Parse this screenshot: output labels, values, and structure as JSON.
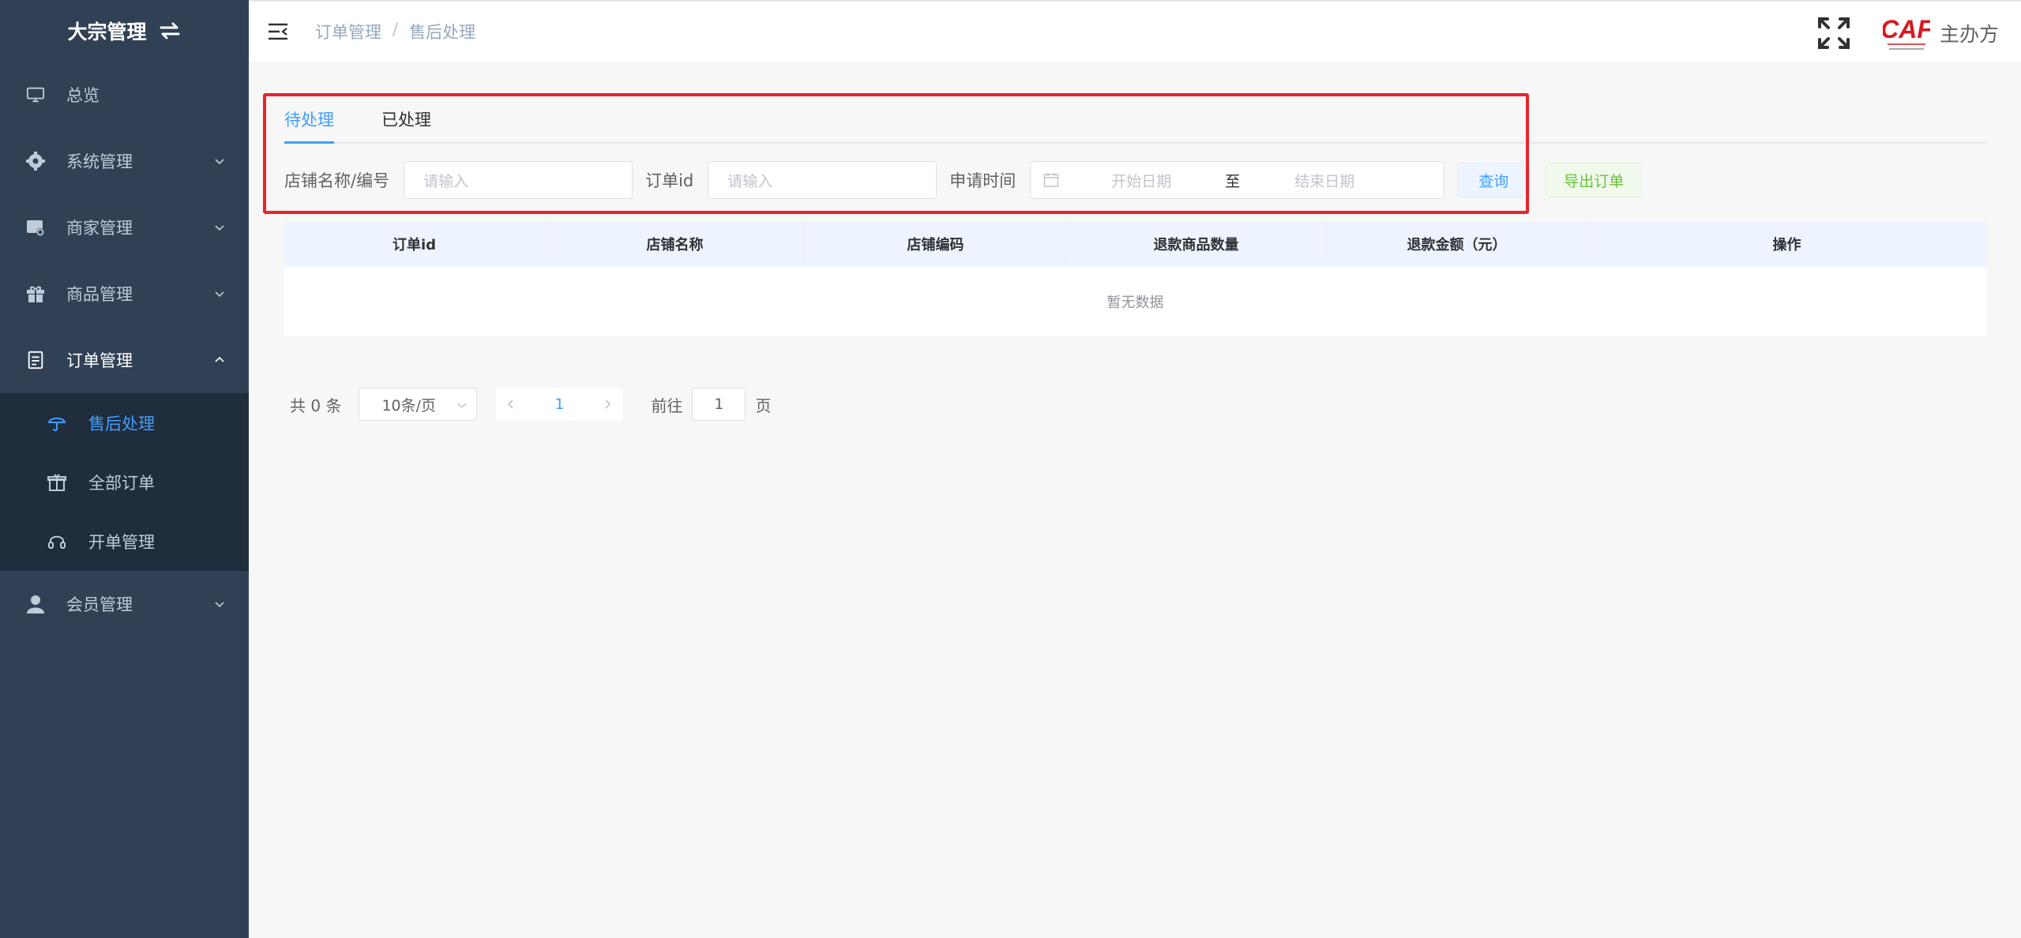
{
  "sidebar": {
    "brand": "大宗管理",
    "items": [
      {
        "label": "总览"
      },
      {
        "label": "系统管理"
      },
      {
        "label": "商家管理"
      },
      {
        "label": "商品管理"
      },
      {
        "label": "订单管理"
      },
      {
        "label": "会员管理"
      }
    ],
    "order_sub": [
      {
        "label": "售后处理"
      },
      {
        "label": "全部订单"
      },
      {
        "label": "开单管理"
      }
    ],
    "colors": {
      "bg": "#304156",
      "sub_bg": "#1f2d3d",
      "active": "#409eff"
    }
  },
  "header": {
    "breadcrumb": [
      "订单管理",
      "售后处理"
    ],
    "org_label": "主办方",
    "logo_text": "CAF"
  },
  "tabs": [
    "待处理",
    "已处理"
  ],
  "filter": {
    "store_label": "店铺名称/编号",
    "store_placeholder": "请输入",
    "order_label": "订单id",
    "order_placeholder": "请输入",
    "time_label": "申请时间",
    "start_placeholder": "开始日期",
    "range_sep": "至",
    "end_placeholder": "结束日期",
    "query_button": "查询",
    "export_button": "导出订单"
  },
  "table": {
    "columns": [
      "订单id",
      "店铺名称",
      "店铺编码",
      "退款商品数量",
      "退款金额（元）",
      "操作"
    ],
    "empty_text": "暂无数据"
  },
  "pagination": {
    "total_text": "共 0 条",
    "page_size": "10条/页",
    "current_page": "1",
    "goto_prefix": "前往",
    "goto_value": "1",
    "goto_suffix": "页"
  }
}
